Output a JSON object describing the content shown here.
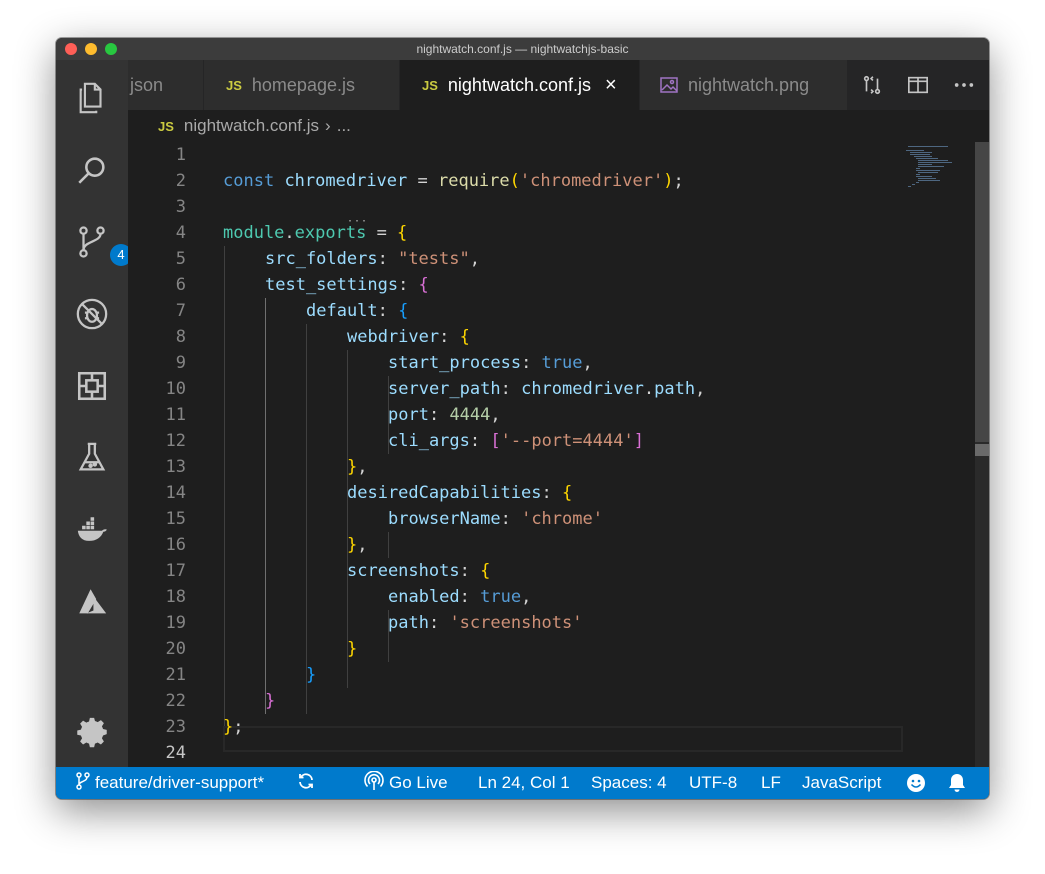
{
  "window": {
    "title": "nightwatch.conf.js — nightwatchjs-basic"
  },
  "activity_bar": {
    "icons": [
      "files-icon",
      "search-icon",
      "source-control-icon",
      "debug-icon",
      "extensions-icon",
      "flask-icon",
      "docker-icon",
      "azure-icon",
      "gear-icon"
    ],
    "source_control_badge": "4"
  },
  "tabs": [
    {
      "label": "json",
      "type": "json",
      "active": false
    },
    {
      "label": "homepage.js",
      "type": "js",
      "badge": "JS",
      "active": false
    },
    {
      "label": "nightwatch.conf.js",
      "type": "js",
      "badge": "JS",
      "active": true,
      "close": "×"
    },
    {
      "label": "nightwatch.png",
      "type": "image",
      "active": false
    }
  ],
  "tab_actions": [
    "open-changes-icon",
    "split-editor-icon",
    "more-actions-icon"
  ],
  "breadcrumbs": {
    "badge": "JS",
    "file": "nightwatch.conf.js",
    "separator": "›",
    "more": "..."
  },
  "editor": {
    "language": "JavaScript",
    "line_numbers": [
      "1",
      "2",
      "3",
      "4",
      "5",
      "6",
      "7",
      "8",
      "9",
      "10",
      "11",
      "12",
      "13",
      "14",
      "15",
      "16",
      "17",
      "18",
      "19",
      "20",
      "21",
      "22",
      "23",
      "24"
    ],
    "code": {
      "l2": {
        "const": "const",
        "name": "chromedriver",
        "eq": " = ",
        "require": "require",
        "paren_open": "(",
        "arg": "'chromedriver'",
        "paren_close": ")",
        "semi": ";"
      },
      "l4": {
        "module": "module",
        "dot": ".",
        "exports": "exports",
        "eq": " = ",
        "brace": "{"
      },
      "l5": {
        "key": "src_folders",
        "colon": ": ",
        "value": "\"tests\"",
        "comma": ","
      },
      "l6": {
        "key": "test_settings",
        "colon": ": ",
        "brace": "{"
      },
      "l7": {
        "key": "default",
        "colon": ": ",
        "brace": "{"
      },
      "l8": {
        "key": "webdriver",
        "colon": ": ",
        "brace": "{"
      },
      "l9": {
        "key": "start_process",
        "colon": ": ",
        "value": "true",
        "comma": ","
      },
      "l10": {
        "key": "server_path",
        "colon": ": ",
        "obj": "chromedriver",
        "dot": ".",
        "prop": "path",
        "comma": ","
      },
      "l11": {
        "key": "port",
        "colon": ": ",
        "value": "4444",
        "comma": ","
      },
      "l12": {
        "key": "cli_args",
        "colon": ": ",
        "open": "[",
        "value": "'--port=4444'",
        "close": "]"
      },
      "l13": {
        "brace": "}",
        "comma": ","
      },
      "l14": {
        "key": "desiredCapabilities",
        "colon": ": ",
        "brace": "{"
      },
      "l15": {
        "key": "browserName",
        "colon": ": ",
        "value": "'chrome'"
      },
      "l16": {
        "brace": "}",
        "comma": ","
      },
      "l17": {
        "key": "screenshots",
        "colon": ": ",
        "brace": "{"
      },
      "l18": {
        "key": "enabled",
        "colon": ": ",
        "value": "true",
        "comma": ","
      },
      "l19": {
        "key": "path",
        "colon": ": ",
        "value": "'screenshots'"
      },
      "l20": {
        "brace": "}"
      },
      "l21": {
        "brace": "}"
      },
      "l22": {
        "brace": "}"
      },
      "l23": {
        "brace": "}",
        "semi": ";"
      }
    }
  },
  "status_bar": {
    "branch": "feature/driver-support*",
    "go_live": "Go Live",
    "position": "Ln 24, Col 1",
    "spaces": "Spaces: 4",
    "encoding": "UTF-8",
    "eol": "LF",
    "language": "JavaScript"
  },
  "colors": {
    "accent": "#007acc",
    "editor_bg": "#1e1e1e",
    "activity_bar": "#333333",
    "keyword": "#569cd6",
    "string": "#ce9178",
    "property": "#9cdcfe",
    "bracket_gold": "#ffd700",
    "bracket_orchid": "#da70d6",
    "bracket_blue": "#179fff"
  }
}
